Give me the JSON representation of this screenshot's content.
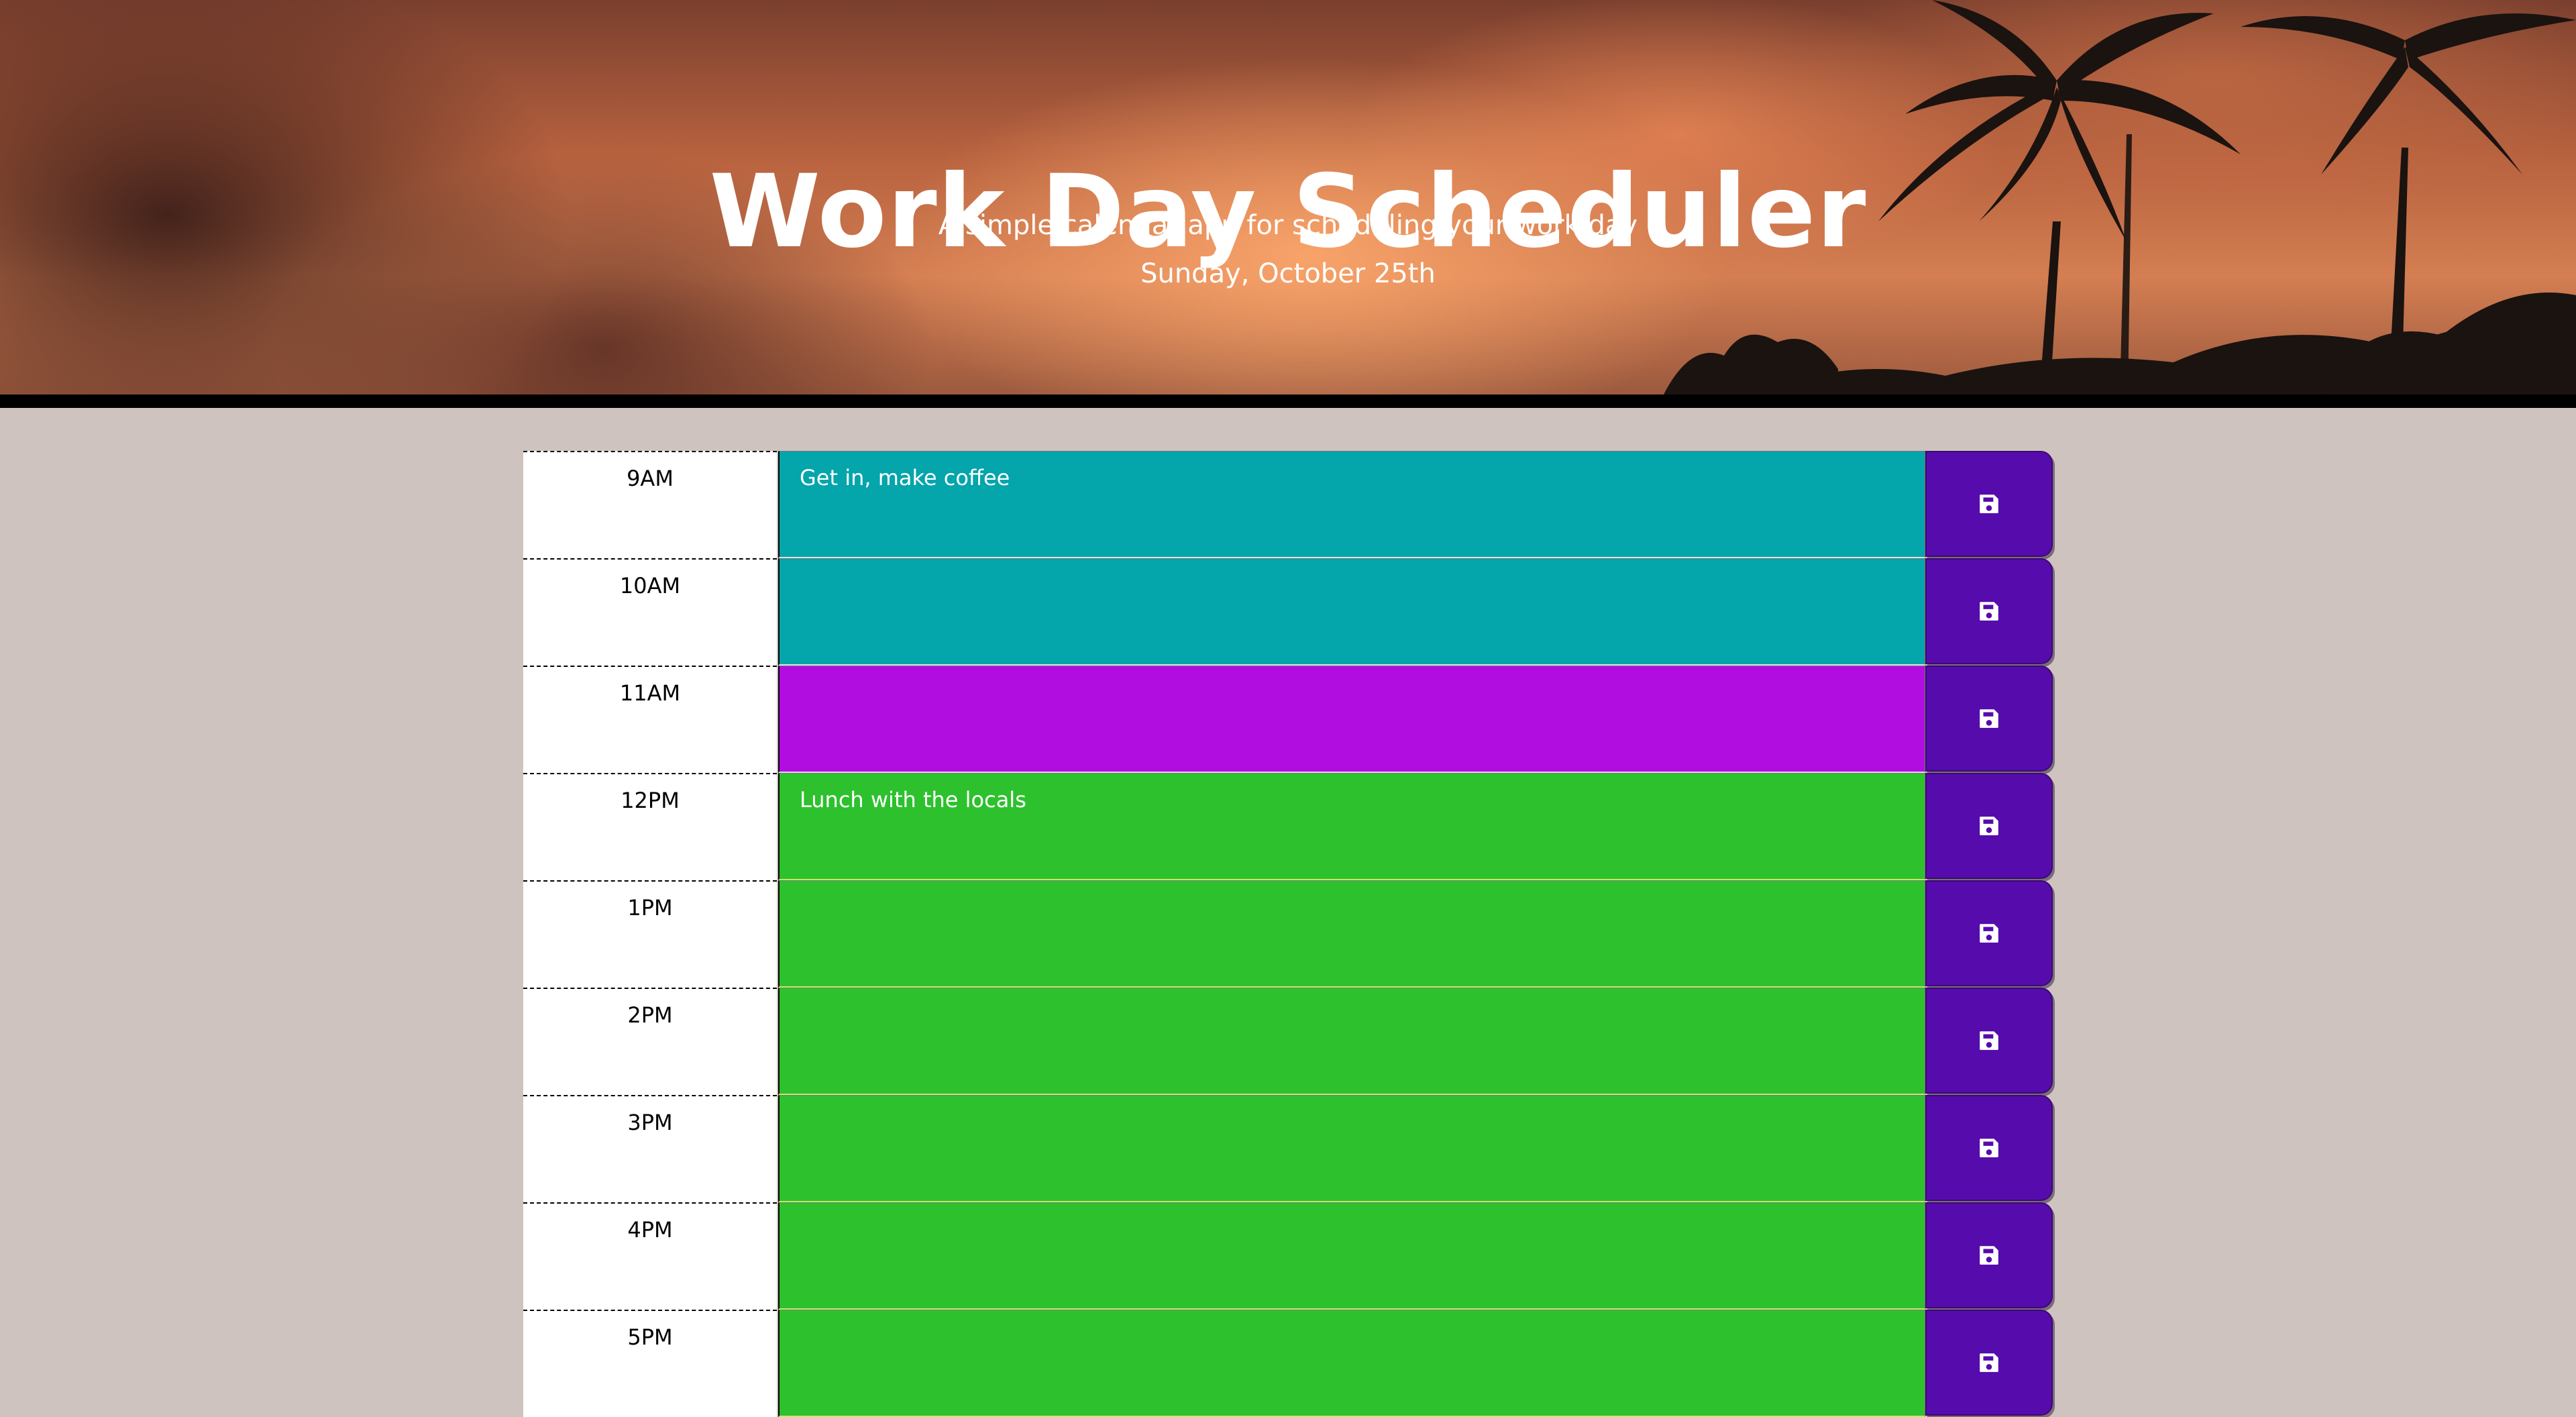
{
  "header": {
    "title": "Work Day Scheduler",
    "subtitle": "A simple calendar app for scheduling your work day",
    "current_day": "Sunday, October 25th"
  },
  "colors": {
    "past": "#04a5ab",
    "present": "#b20de0",
    "future": "#2dc12e",
    "save_button": "#560bad",
    "page_background": "#cfc3bf"
  },
  "time_blocks": [
    {
      "hour": "9AM",
      "event": "Get in, make coffee",
      "status": "past",
      "save_icon": "save-icon"
    },
    {
      "hour": "10AM",
      "event": "",
      "status": "past",
      "save_icon": "save-icon"
    },
    {
      "hour": "11AM",
      "event": "",
      "status": "present",
      "save_icon": "save-icon"
    },
    {
      "hour": "12PM",
      "event": "Lunch with the locals",
      "status": "future",
      "save_icon": "save-icon"
    },
    {
      "hour": "1PM",
      "event": "",
      "status": "future",
      "save_icon": "save-icon"
    },
    {
      "hour": "2PM",
      "event": "",
      "status": "future",
      "save_icon": "save-icon"
    },
    {
      "hour": "3PM",
      "event": "",
      "status": "future",
      "save_icon": "save-icon"
    },
    {
      "hour": "4PM",
      "event": "",
      "status": "future",
      "save_icon": "save-icon"
    },
    {
      "hour": "5PM",
      "event": "",
      "status": "future",
      "save_icon": "save-icon"
    }
  ]
}
